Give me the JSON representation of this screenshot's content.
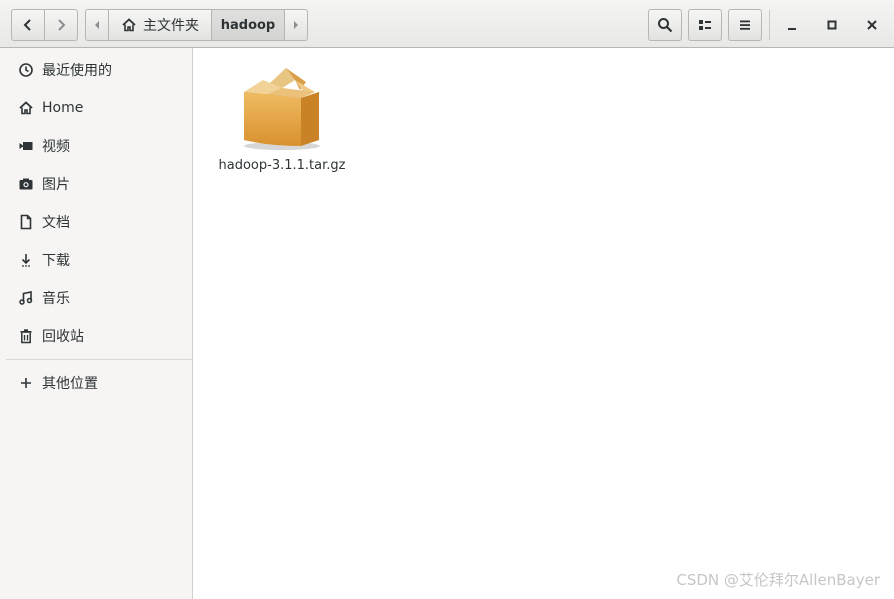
{
  "headerbar": {
    "path_home_label": "主文件夹",
    "path_current_label": "hadoop",
    "icons": {
      "back": "chevron-left-icon",
      "forward": "chevron-right-icon",
      "path_left": "path-scroll-left-icon",
      "path_home": "home-icon",
      "path_right": "path-scroll-right-icon",
      "search": "search-icon",
      "view": "list-view-icon",
      "menu": "hamburger-menu-icon",
      "minimize": "minimize-icon",
      "maximize": "maximize-icon",
      "close": "close-icon"
    }
  },
  "sidebar": {
    "items": [
      {
        "label": "最近使用的",
        "icon": "recent-clock-icon"
      },
      {
        "label": "Home",
        "icon": "home-icon"
      },
      {
        "label": "视频",
        "icon": "video-icon"
      },
      {
        "label": "图片",
        "icon": "camera-icon"
      },
      {
        "label": "文档",
        "icon": "document-icon"
      },
      {
        "label": "下载",
        "icon": "download-icon"
      },
      {
        "label": "音乐",
        "icon": "music-icon"
      },
      {
        "label": "回收站",
        "icon": "trash-icon"
      }
    ],
    "other_locations": {
      "label": "其他位置",
      "icon": "plus-icon"
    }
  },
  "content": {
    "files": [
      {
        "name": "hadoop-3.1.1.tar.gz",
        "icon": "package-archive-icon"
      }
    ]
  },
  "watermark": "CSDN @艾伦拜尔AllenBayer",
  "colors": {
    "headerbar": "#e8e8e7",
    "sidebar": "#f6f5f4",
    "content": "#ffffff",
    "text": "#2e3436",
    "archive_box": "#e0a54a"
  }
}
